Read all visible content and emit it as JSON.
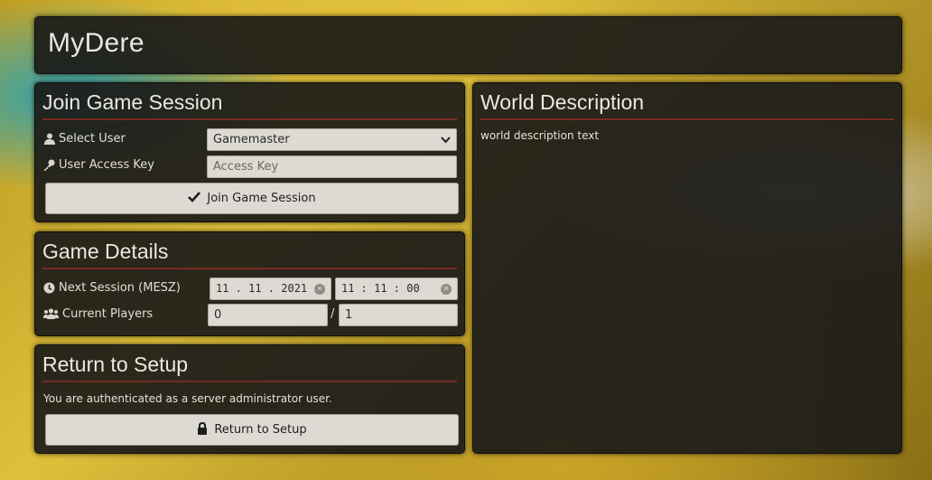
{
  "app": {
    "title": "MyDere"
  },
  "join": {
    "heading": "Join Game Session",
    "select_user_label": "Select User",
    "select_user_value": "Gamemaster",
    "access_key_label": "User Access Key",
    "access_key_placeholder": "Access Key",
    "join_button": "Join Game Session"
  },
  "details": {
    "heading": "Game Details",
    "next_session_label": "Next Session (MESZ)",
    "date_value": "11 . 11 . 2021",
    "time_value": "11 : 11 : 00",
    "players_label": "Current Players",
    "players_current": "0",
    "players_separator": "/",
    "players_max": "1"
  },
  "setup": {
    "heading": "Return to Setup",
    "note": "You are authenticated as a server administrator user.",
    "button": "Return to Setup"
  },
  "world": {
    "heading": "World Description",
    "text": "world description text"
  },
  "icons": {
    "user": "user-icon",
    "key": "key-icon",
    "check": "check-icon",
    "clock": "clock-icon",
    "users": "users-icon",
    "lock": "lock-icon",
    "chevron": "chevron-down-icon",
    "clear": "clear-icon"
  },
  "colors": {
    "accent_rule": "#7a2a22",
    "panel_bg": "#1c1b19",
    "field_bg": "#dcdad2"
  }
}
